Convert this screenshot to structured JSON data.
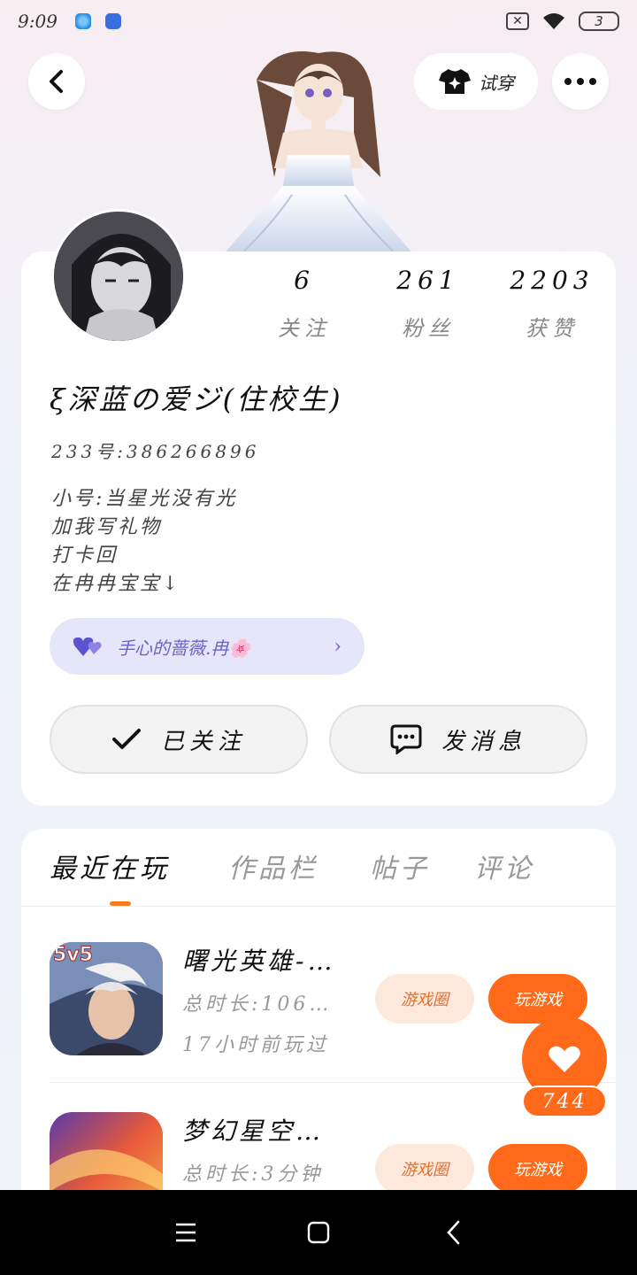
{
  "status_bar": {
    "time": "9:09",
    "battery": "3"
  },
  "header": {
    "tryon_label": "试穿"
  },
  "profile": {
    "stats": [
      {
        "value": "6",
        "label": "关注"
      },
      {
        "value": "261",
        "label": "粉丝"
      },
      {
        "value": "2203",
        "label": "获赞"
      }
    ],
    "nickname": "ξ深蓝の爱ジ(住校生)",
    "uid": "233号:386266896",
    "bio": [
      "小号:当星光没有光",
      "加我写礼物",
      "打卡回",
      "在冉冉宝宝↓"
    ],
    "intimacy_tag": "手心的蔷薇.冉🌸",
    "follow_label": "已关注",
    "message_label": "发消息"
  },
  "tabs": [
    {
      "label": "最近在玩",
      "active": true
    },
    {
      "label": "作品栏",
      "active": false
    },
    {
      "label": "帖子",
      "active": false
    },
    {
      "label": "评论",
      "active": false
    }
  ],
  "games": [
    {
      "name": "曙光英雄-…",
      "duration": "总时长:106…",
      "last_played": "17小时前玩过",
      "icon_badge": "5v5",
      "circle_label": "游戏圈",
      "play_label": "玩游戏"
    },
    {
      "name": "梦幻星空…",
      "duration": "总时长:3分钟",
      "last_played": "",
      "icon_badge": "",
      "circle_label": "游戏圈",
      "play_label": "玩游戏"
    }
  ],
  "like": {
    "count": "744"
  },
  "colors": {
    "accent": "#ff6a1a",
    "intimacy": "#6a64c8"
  }
}
